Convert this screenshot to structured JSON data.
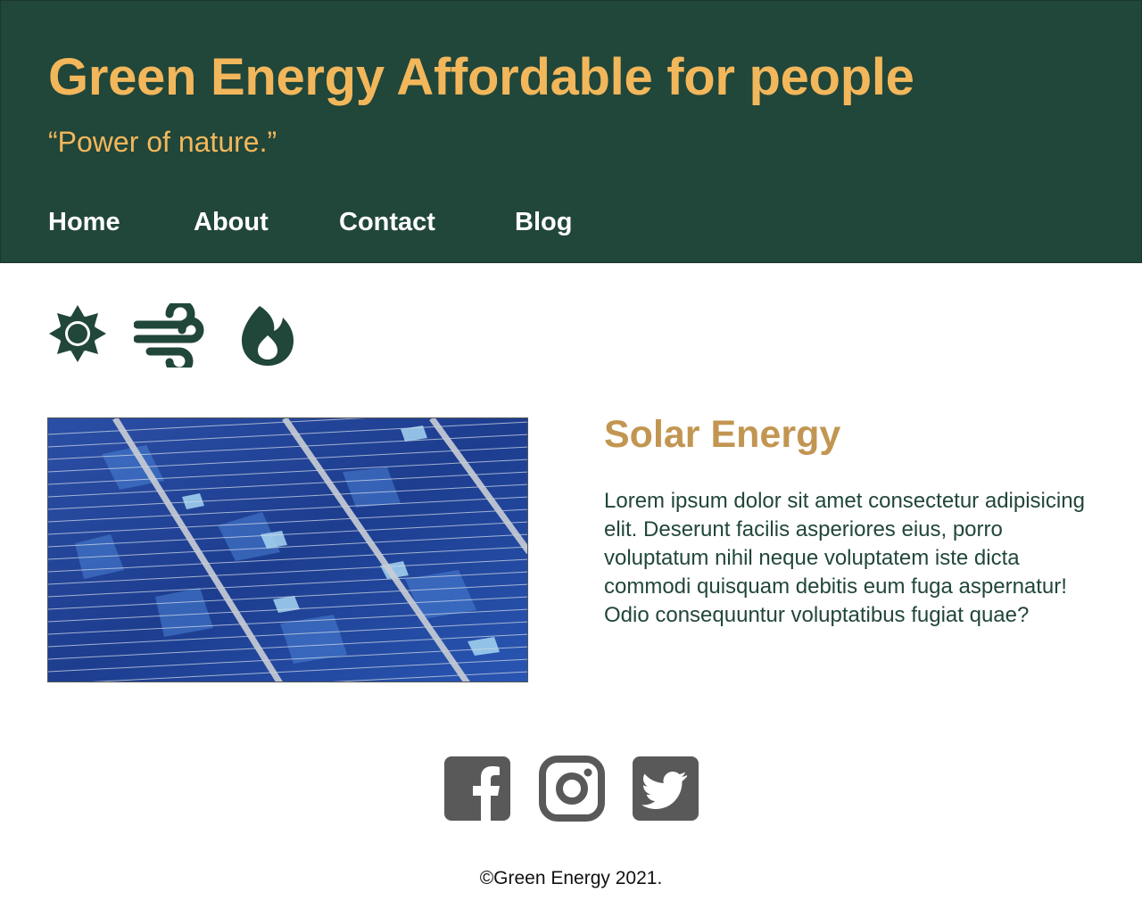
{
  "header": {
    "title": "Green Energy Affordable for people",
    "tagline": "“Power of nature.”",
    "nav": [
      {
        "label": "Home"
      },
      {
        "label": "About"
      },
      {
        "label": "Contact"
      },
      {
        "label": "Blog"
      }
    ]
  },
  "energy_icons": [
    "sun-icon",
    "wind-icon",
    "fire-icon"
  ],
  "section": {
    "title": "Solar Energy",
    "body": "Lorem ipsum dolor sit amet consectetur adipisicing elit. Deserunt facilis asperiores eius, porro voluptatum nihil neque voluptatem iste dicta commodi quisquam debitis eum fuga aspernatur! Odio consequuntur voluptatibus fugiat quae?"
  },
  "social_icons": [
    "facebook-icon",
    "instagram-icon",
    "twitter-icon"
  ],
  "footer": {
    "copyright": "©Green Energy 2021."
  },
  "colors": {
    "header_bg": "#21463a",
    "accent": "#f3b75b",
    "section_title": "#c29652",
    "body_text": "#21463a",
    "social_icon": "#595959"
  }
}
